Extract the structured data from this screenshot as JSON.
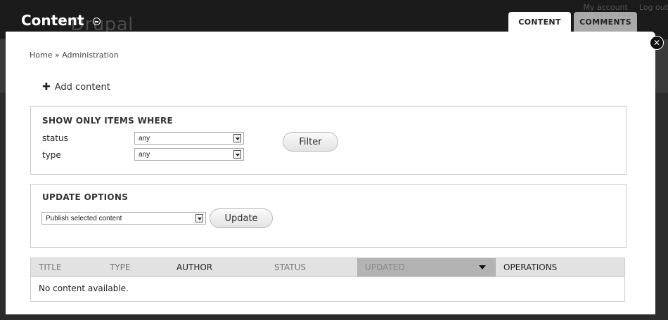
{
  "background": {
    "logo": "Drupal",
    "links": [
      "My account",
      "Log out"
    ]
  },
  "overlay": {
    "title": "Content"
  },
  "tabs": [
    {
      "label": "CONTENT",
      "active": true
    },
    {
      "label": "COMMENTS",
      "active": false
    }
  ],
  "breadcrumb": "Home » Administration",
  "add_content": "Add content",
  "filter": {
    "legend": "SHOW ONLY ITEMS WHERE",
    "status_label": "status",
    "status_value": "any",
    "type_label": "type",
    "type_value": "any",
    "button": "Filter"
  },
  "update": {
    "legend": "UPDATE OPTIONS",
    "selected": "Publish selected content",
    "button": "Update"
  },
  "table": {
    "columns": [
      "TITLE",
      "TYPE",
      "AUTHOR",
      "STATUS",
      "UPDATED",
      "OPERATIONS"
    ],
    "empty": "No content available."
  }
}
